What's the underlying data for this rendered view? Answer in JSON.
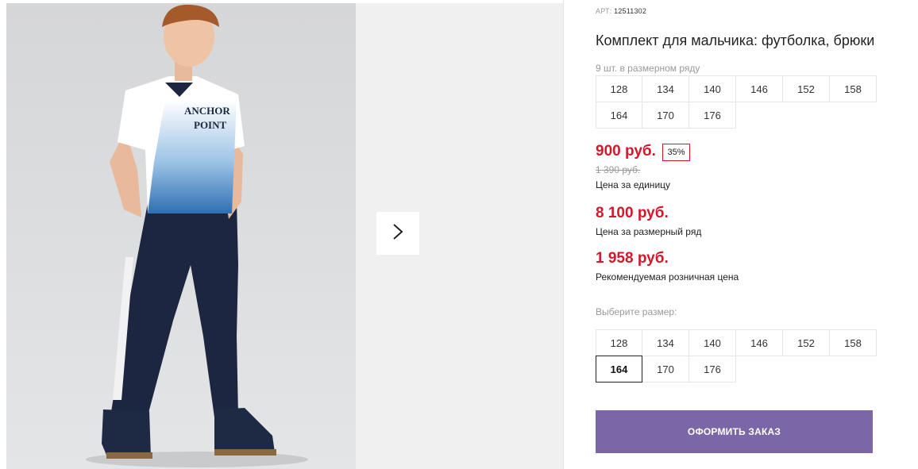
{
  "product": {
    "art_label": "АРТ:",
    "art_value": "12511302",
    "title": "Комплект для мальчика: футболка, брюки",
    "size_count": "9 шт. в размерном ряду",
    "size_row": [
      "128",
      "134",
      "140",
      "146",
      "152",
      "158",
      "164",
      "170",
      "176"
    ]
  },
  "photo": {
    "shirt_print_line1": "ANCHOR",
    "shirt_print_line2": "POINT"
  },
  "prices": {
    "unit_price": "900 руб.",
    "discount": "35%",
    "old_price": "1 390 руб.",
    "unit_label": "Цена за единицу",
    "row_price": "8 100 руб.",
    "row_label": "Цена за размерный ряд",
    "retail_price": "1 958 руб.",
    "retail_label": "Рекомендуемая розничная цена"
  },
  "size_select": {
    "label": "Выберите размер:",
    "options": [
      "128",
      "134",
      "140",
      "146",
      "152",
      "158",
      "164",
      "170",
      "176"
    ],
    "selected": "164"
  },
  "order_button": "ОФОРМИТЬ ЗАКАЗ",
  "colors": {
    "accent_red": "#d3182b",
    "button_purple": "#7b66a8"
  },
  "icons": {
    "next": "chevron-right-icon"
  }
}
